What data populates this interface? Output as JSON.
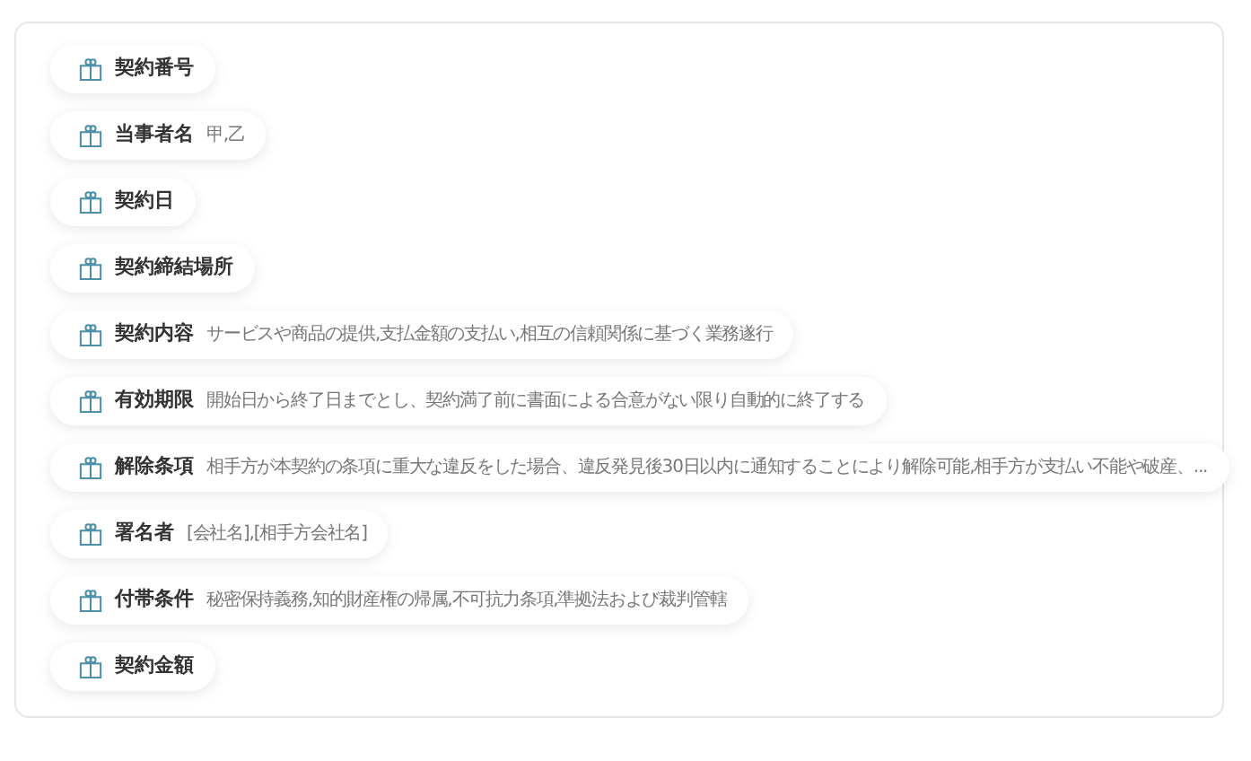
{
  "fields": [
    {
      "label": "契約番号"
    },
    {
      "label": "当事者名",
      "value": "甲,乙"
    },
    {
      "label": "契約日"
    },
    {
      "label": "契約締結場所"
    },
    {
      "label": "契約内容",
      "value": "サービスや商品の提供,支払金額の支払い,相互の信頼関係に基づく業務遂行"
    },
    {
      "label": "有効期限",
      "value": "開始日から終了日までとし、契約満了前に書面による合意がない限り自動的に終了する"
    },
    {
      "label": "解除条項",
      "value": "相手方が本契約の条項に重大な違反をした場合、違反発見後30日以内に通知することにより解除可能,相手方が支払い不能や破産、..."
    },
    {
      "label": "署名者",
      "value": "[会社名],[相手方会社名]"
    },
    {
      "label": "付帯条件",
      "value": "秘密保持義務,知的財産権の帰属,不可抗力条項,準拠法および裁判管轄"
    },
    {
      "label": "契約金額"
    }
  ]
}
